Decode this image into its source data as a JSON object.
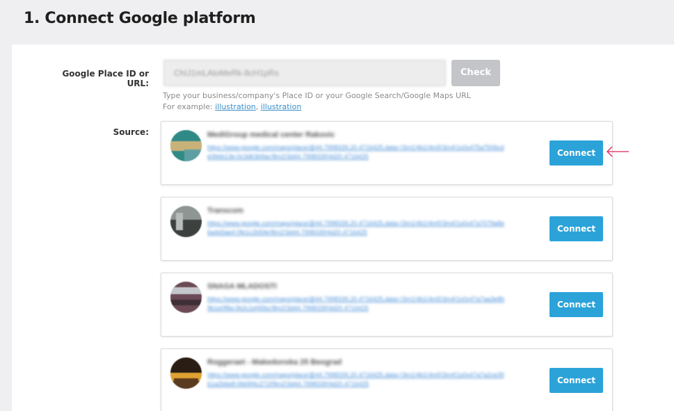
{
  "header": {
    "title": "1. Connect Google platform"
  },
  "form": {
    "place_label": "Google Place ID or URL:",
    "place_value": "ChIJ1mLAtoMeRk-8cH1pRs",
    "check_label": "Check",
    "hint_line1": "Type your business/company's Place ID or your Google Search/Google Maps URL",
    "hint_prefix": "For example:",
    "example_link_1": "illustration",
    "example_link_2": "illustration",
    "source_label": "Source:"
  },
  "sources": [
    {
      "name": "MediGroup medical center Rakovic",
      "link": "https://www.google.com/maps/place/@44.7998339,20.4716425,data=!3m1!4b1!4m5!3m4!1s0x475a7506cde0bbb13e:0c3d63b9ac!8m2!3d44.7998339!4d20.4716425",
      "connect_label": "Connect",
      "avatar_colors": [
        "#2f8a86",
        "#c9b27a",
        "#5f9fa3"
      ]
    },
    {
      "name": "Transcom",
      "link": "https://www.google.com/maps/place/@44.7998339,20.4716425,data=!3m1!4b1!4m5!3m4!1s0x47a7079a8e6a4d3ae4:0fe1c2b59e!8m2!3d44.7998339!4d20.4716425",
      "connect_label": "Connect",
      "avatar_colors": [
        "#8e9694",
        "#3c4140",
        "#b8bcbb"
      ]
    },
    {
      "name": "SNAGA MLADOSTI",
      "link": "https://www.google.com/maps/place/@44.7998339,20.4716425,data=!3m1!4b1!4m5!3m4!1s0x47a7aa3e8b9b1e0f8a:0b2c1ef45bc!8m2!3d44.7998339!4d20.4716425",
      "connect_label": "Connect",
      "avatar_colors": [
        "#6b4a55",
        "#c4c7cc",
        "#3e2f36"
      ]
    },
    {
      "name": "Roggeraet - Makedonska 25 Beograd",
      "link": "https://www.google.com/maps/place/@44.7998339,20.4716425,data=!3m1!4b1!4m5!3m4!1s0x47a7a2ce39b1a2b6e8:06b9f4c271f!8m2!3d44.7998339!4d20.4716425",
      "connect_label": "Connect",
      "avatar_colors": [
        "#2a1e14",
        "#e0a232",
        "#5a3b1f"
      ]
    }
  ],
  "colors": {
    "accent": "#2ba3d9",
    "check_disabled": "#c3c5c8",
    "arrow": "#e0245e"
  },
  "icons": {
    "pointer_arrow": "left-arrow-icon"
  }
}
